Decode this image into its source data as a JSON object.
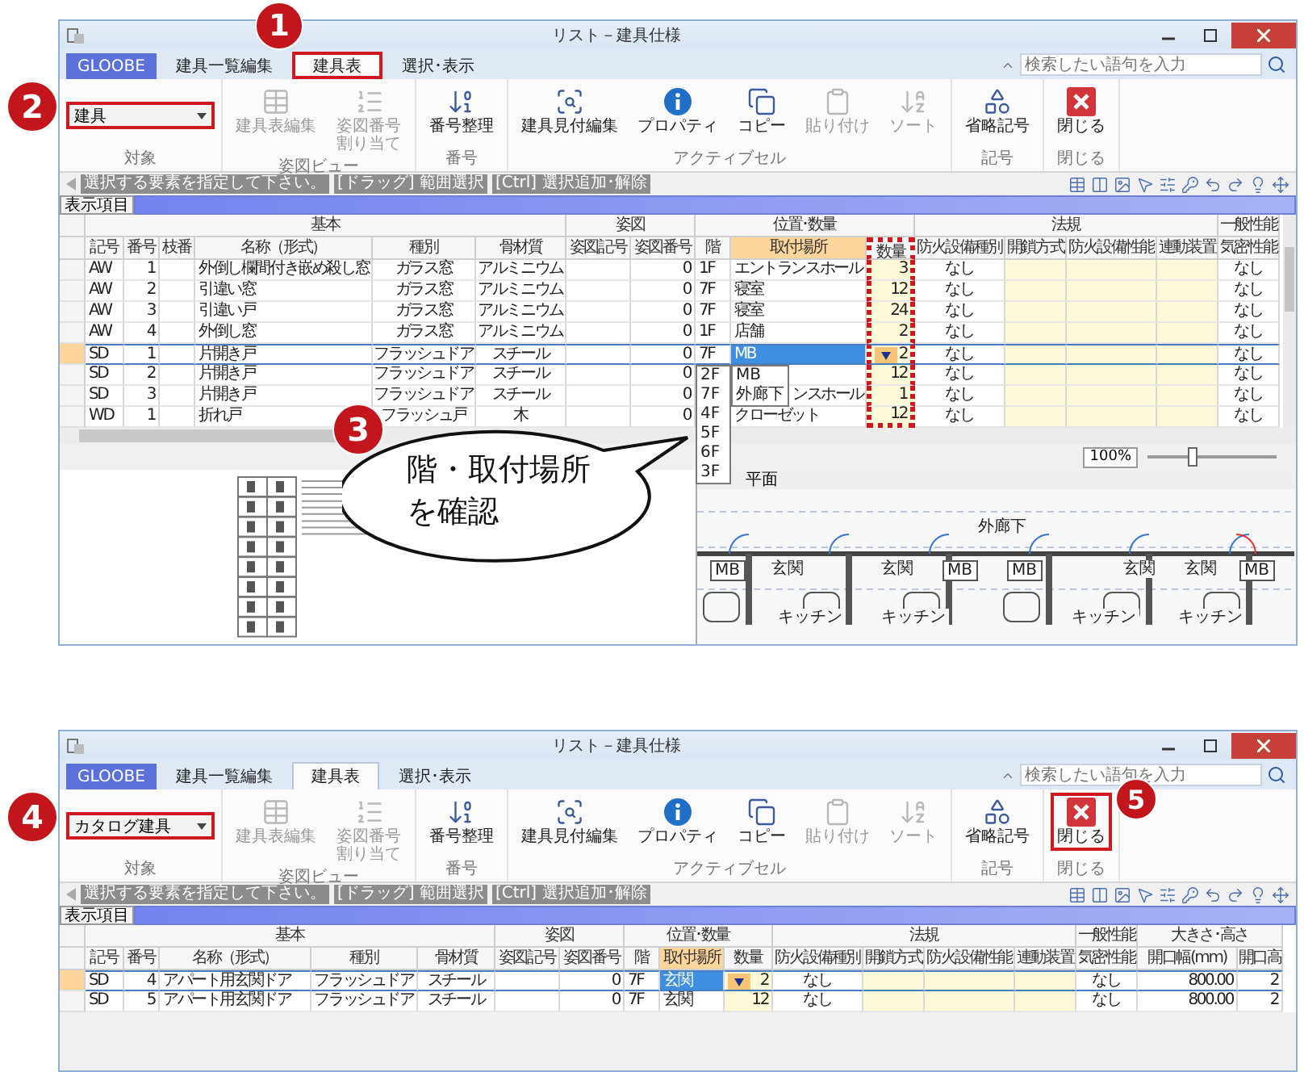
{
  "steps": [
    {
      "number": "1"
    },
    {
      "number": "2"
    },
    {
      "number": "3"
    },
    {
      "number": "4"
    },
    {
      "number": "5"
    }
  ],
  "callout": {
    "text": "階・取付場所を確認"
  },
  "windows": [
    {
      "title": "リスト－建具仕様",
      "app_button": "GLOOBE",
      "tabs": [
        {
          "label": "建具一覧編集",
          "selected": false,
          "highlighted": false
        },
        {
          "label": "建具表",
          "selected": true,
          "highlighted": true
        },
        {
          "label": "選択･表示",
          "selected": false,
          "highlighted": false
        }
      ],
      "search": {
        "placeholder": "検索したい語句を入力"
      },
      "ribbon": [
        {
          "label": "対象",
          "items": [
            {
              "kind": "dropdown",
              "value": "建具",
              "highlighted": true
            }
          ]
        },
        {
          "label": "姿図ビュー",
          "items": [
            {
              "kind": "button",
              "label": "建具表編集",
              "disabled": true,
              "highlighted": false
            },
            {
              "kind": "button",
              "label": "姿図番号割り当て",
              "disabled": true,
              "highlighted": false
            }
          ]
        },
        {
          "label": "番号",
          "items": [
            {
              "kind": "button",
              "label": "番号整理",
              "disabled": false,
              "highlighted": false
            }
          ]
        },
        {
          "label": "アクティブセル",
          "items": [
            {
              "kind": "button",
              "label": "建具見付編集",
              "disabled": false,
              "highlighted": false
            },
            {
              "kind": "button",
              "label": "プロパティ",
              "disabled": false,
              "highlighted": false
            },
            {
              "kind": "button",
              "label": "コピー",
              "disabled": false,
              "highlighted": false
            },
            {
              "kind": "button",
              "label": "貼り付け",
              "disabled": true,
              "highlighted": false
            },
            {
              "kind": "button",
              "label": "ソート",
              "disabled": true,
              "highlighted": false
            }
          ]
        },
        {
          "label": "記号",
          "items": [
            {
              "kind": "button",
              "label": "省略記号",
              "disabled": false,
              "highlighted": false
            }
          ]
        },
        {
          "label": "閉じる",
          "items": [
            {
              "kind": "button",
              "label": "閉じる",
              "disabled": false,
              "highlighted": false
            }
          ]
        }
      ],
      "hints": [
        "選択する要素を指定して下さい。",
        "[ドラッグ] 範囲選択",
        "[Ctrl] 選択追加･解除"
      ],
      "display_items": "表示項目",
      "table": {
        "groups": [
          {
            "label": "基本",
            "columns": [
              {
                "label": "記号",
                "editable": false,
                "selected": false,
                "highlighted": false
              },
              {
                "label": "番号",
                "editable": false,
                "selected": false,
                "highlighted": false
              },
              {
                "label": "枝番",
                "editable": false,
                "selected": false,
                "highlighted": false
              },
              {
                "label": "名称（形式）",
                "editable": false,
                "selected": false,
                "highlighted": false
              },
              {
                "label": "種別",
                "editable": false,
                "selected": false,
                "highlighted": false
              },
              {
                "label": "骨材質",
                "editable": false,
                "selected": false,
                "highlighted": false
              }
            ]
          },
          {
            "label": "姿図",
            "columns": [
              {
                "label": "姿図記号",
                "editable": false,
                "selected": false,
                "highlighted": false
              },
              {
                "label": "姿図番号",
                "editable": false,
                "selected": false,
                "highlighted": false
              }
            ]
          },
          {
            "label": "位置･数量",
            "columns": [
              {
                "label": "階",
                "editable": false,
                "selected": false,
                "highlighted": false
              },
              {
                "label": "取付場所",
                "editable": false,
                "selected": true,
                "highlighted": false
              },
              {
                "label": "数量",
                "editable": true,
                "selected": false,
                "highlighted": true
              }
            ]
          },
          {
            "label": "法規",
            "columns": [
              {
                "label": "防火設備種別",
                "editable": false,
                "selected": false,
                "highlighted": false
              },
              {
                "label": "開鎖方式",
                "editable": true,
                "selected": false,
                "highlighted": false
              },
              {
                "label": "防火設備性能",
                "editable": true,
                "selected": false,
                "highlighted": false
              },
              {
                "label": "連動装置",
                "editable": true,
                "selected": false,
                "highlighted": false
              }
            ]
          },
          {
            "label": "一般性能",
            "columns": [
              {
                "label": "気密性能",
                "editable": false,
                "selected": false,
                "highlighted": false
              }
            ]
          }
        ],
        "rows": [
          {
            "selected": false,
            "cells": [
              "AW",
              "1",
              null,
              "外倒し欄間付き嵌め殺し窓",
              "ガラス窓",
              "アルミニウム",
              null,
              "0",
              "1F",
              "エントランスホール",
              "3",
              "なし",
              null,
              null,
              null,
              "なし"
            ]
          },
          {
            "selected": false,
            "cells": [
              "AW",
              "2",
              null,
              "引違い窓",
              "ガラス窓",
              "アルミニウム",
              null,
              "0",
              "7F",
              "寝室",
              "12",
              "なし",
              null,
              null,
              null,
              "なし"
            ]
          },
          {
            "selected": false,
            "cells": [
              "AW",
              "3",
              null,
              "引違い戸",
              "ガラス窓",
              "アルミニウム",
              null,
              "0",
              "7F",
              "寝室",
              "24",
              "なし",
              null,
              null,
              null,
              "なし"
            ]
          },
          {
            "selected": false,
            "cells": [
              "AW",
              "4",
              null,
              "外倒し窓",
              "ガラス窓",
              "アルミニウム",
              null,
              "0",
              "1F",
              "店舗",
              "2",
              "なし",
              null,
              null,
              null,
              "なし"
            ]
          },
          {
            "selected": true,
            "cells": [
              "SD",
              "1",
              null,
              "片開き戸",
              "フラッシュドア",
              "スチール",
              null,
              "0",
              "7F",
              {
                "text": "MB",
                "active": true
              },
              {
                "text": "2",
                "dropdown": true
              },
              "なし",
              null,
              null,
              null,
              "なし"
            ]
          },
          {
            "selected": false,
            "cells": [
              "SD",
              "2",
              null,
              "片開き戸",
              "フラッシュドア",
              "スチール",
              null,
              "0",
              null,
              null,
              "12",
              "なし",
              null,
              null,
              null,
              "なし"
            ]
          },
          {
            "selected": false,
            "cells": [
              "SD",
              "3",
              null,
              "片開き戸",
              "フラッシュドア",
              "スチール",
              null,
              "0",
              null,
              "ンスホール",
              "1",
              "なし",
              null,
              null,
              null,
              "なし"
            ]
          },
          {
            "selected": false,
            "cells": [
              "WD",
              "1",
              null,
              "折れ戸",
              "フラッシュ戸",
              "木",
              null,
              "0",
              null,
              "クローゼット",
              "12",
              "なし",
              null,
              null,
              null,
              "なし"
            ]
          }
        ],
        "floor_dropdown": {
          "options": [
            "2F",
            "7F",
            "4F",
            "5F",
            "6F",
            "3F"
          ]
        },
        "location_dropdown": {
          "options": [
            "MB",
            "外廊下"
          ]
        }
      },
      "zoom": {
        "reading": "100%",
        "level": 0.35
      },
      "plan": {
        "title": "平面",
        "labels": [
          {
            "text": "外廊下",
            "kind": "plain"
          },
          {
            "text": "MB",
            "kind": "box"
          },
          {
            "text": "玄関",
            "kind": "plain"
          },
          {
            "text": "玄関",
            "kind": "plain"
          },
          {
            "text": "MB",
            "kind": "box"
          },
          {
            "text": "MB",
            "kind": "box"
          },
          {
            "text": "玄関",
            "kind": "plain"
          },
          {
            "text": "玄関",
            "kind": "plain"
          },
          {
            "text": "MB",
            "kind": "box"
          },
          {
            "text": "キッチン",
            "kind": "plain"
          },
          {
            "text": "キッチン",
            "kind": "plain"
          },
          {
            "text": "キッチン",
            "kind": "plain"
          },
          {
            "text": "キッチン",
            "kind": "plain"
          }
        ]
      }
    },
    {
      "title": "リスト－建具仕様",
      "app_button": "GLOOBE",
      "tabs": [
        {
          "label": "建具一覧編集",
          "selected": false,
          "highlighted": false
        },
        {
          "label": "建具表",
          "selected": true,
          "highlighted": false
        },
        {
          "label": "選択･表示",
          "selected": false,
          "highlighted": false
        }
      ],
      "search": {
        "placeholder": "検索したい語句を入力"
      },
      "ribbon": [
        {
          "label": "対象",
          "items": [
            {
              "kind": "dropdown",
              "value": "カタログ建具",
              "highlighted": true
            }
          ]
        },
        {
          "label": "姿図ビュー",
          "items": [
            {
              "kind": "button",
              "label": "建具表編集",
              "disabled": true,
              "highlighted": false
            },
            {
              "kind": "button",
              "label": "姿図番号割り当て",
              "disabled": true,
              "highlighted": false
            }
          ]
        },
        {
          "label": "番号",
          "items": [
            {
              "kind": "button",
              "label": "番号整理",
              "disabled": false,
              "highlighted": false
            }
          ]
        },
        {
          "label": "アクティブセル",
          "items": [
            {
              "kind": "button",
              "label": "建具見付編集",
              "disabled": false,
              "highlighted": false
            },
            {
              "kind": "button",
              "label": "プロパティ",
              "disabled": false,
              "highlighted": false
            },
            {
              "kind": "button",
              "label": "コピー",
              "disabled": false,
              "highlighted": false
            },
            {
              "kind": "button",
              "label": "貼り付け",
              "disabled": true,
              "highlighted": false
            },
            {
              "kind": "button",
              "label": "ソート",
              "disabled": true,
              "highlighted": false
            }
          ]
        },
        {
          "label": "記号",
          "items": [
            {
              "kind": "button",
              "label": "省略記号",
              "disabled": false,
              "highlighted": false
            }
          ]
        },
        {
          "label": "閉じる",
          "items": [
            {
              "kind": "button",
              "label": "閉じる",
              "disabled": false,
              "highlighted": true
            }
          ]
        }
      ],
      "hints": [
        "選択する要素を指定して下さい。",
        "[ドラッグ] 範囲選択",
        "[Ctrl] 選択追加･解除"
      ],
      "display_items": "表示項目",
      "table": {
        "groups": [
          {
            "label": "基本",
            "columns": [
              {
                "label": "記号",
                "editable": false,
                "selected": false,
                "highlighted": false
              },
              {
                "label": "番号",
                "editable": false,
                "selected": false,
                "highlighted": false
              },
              {
                "label": "名称（形式）",
                "editable": false,
                "selected": false,
                "highlighted": false
              },
              {
                "label": "種別",
                "editable": false,
                "selected": false,
                "highlighted": false
              },
              {
                "label": "骨材質",
                "editable": false,
                "selected": false,
                "highlighted": false
              }
            ]
          },
          {
            "label": "姿図",
            "columns": [
              {
                "label": "姿図記号",
                "editable": false,
                "selected": false,
                "highlighted": false
              },
              {
                "label": "姿図番号",
                "editable": false,
                "selected": false,
                "highlighted": false
              }
            ]
          },
          {
            "label": "位置･数量",
            "columns": [
              {
                "label": "階",
                "editable": false,
                "selected": false,
                "highlighted": false
              },
              {
                "label": "取付場所",
                "editable": false,
                "selected": true,
                "highlighted": false
              },
              {
                "label": "数量",
                "editable": true,
                "selected": false,
                "highlighted": false
              }
            ]
          },
          {
            "label": "法規",
            "columns": [
              {
                "label": "防火設備種別",
                "editable": false,
                "selected": false,
                "highlighted": false
              },
              {
                "label": "開鎖方式",
                "editable": true,
                "selected": false,
                "highlighted": false
              },
              {
                "label": "防火設備性能",
                "editable": true,
                "selected": false,
                "highlighted": false
              },
              {
                "label": "連動装置",
                "editable": true,
                "selected": false,
                "highlighted": false
              }
            ]
          },
          {
            "label": "一般性能",
            "columns": [
              {
                "label": "気密性能",
                "editable": false,
                "selected": false,
                "highlighted": false
              }
            ]
          },
          {
            "label": "大きさ･高さ",
            "columns": [
              {
                "label": "開口幅(mm)",
                "editable": false,
                "selected": false,
                "highlighted": false
              },
              {
                "label": "開口高",
                "editable": false,
                "selected": false,
                "highlighted": false
              }
            ]
          }
        ],
        "rows": [
          {
            "selected": true,
            "cells": [
              "SD",
              "4",
              "アパート用玄関ドア",
              "フラッシュドア",
              "スチール",
              null,
              "0",
              "7F",
              {
                "text": "玄関",
                "active": true
              },
              {
                "text": "2",
                "dropdown": true
              },
              "なし",
              null,
              null,
              null,
              "なし",
              "800.00",
              "2"
            ]
          },
          {
            "selected": false,
            "cells": [
              "SD",
              "5",
              "アパート用玄関ドア",
              "フラッシュドア",
              "スチール",
              null,
              "0",
              "7F",
              "玄関",
              "12",
              "なし",
              null,
              null,
              null,
              "なし",
              "800.00",
              "2"
            ]
          }
        ]
      }
    }
  ]
}
